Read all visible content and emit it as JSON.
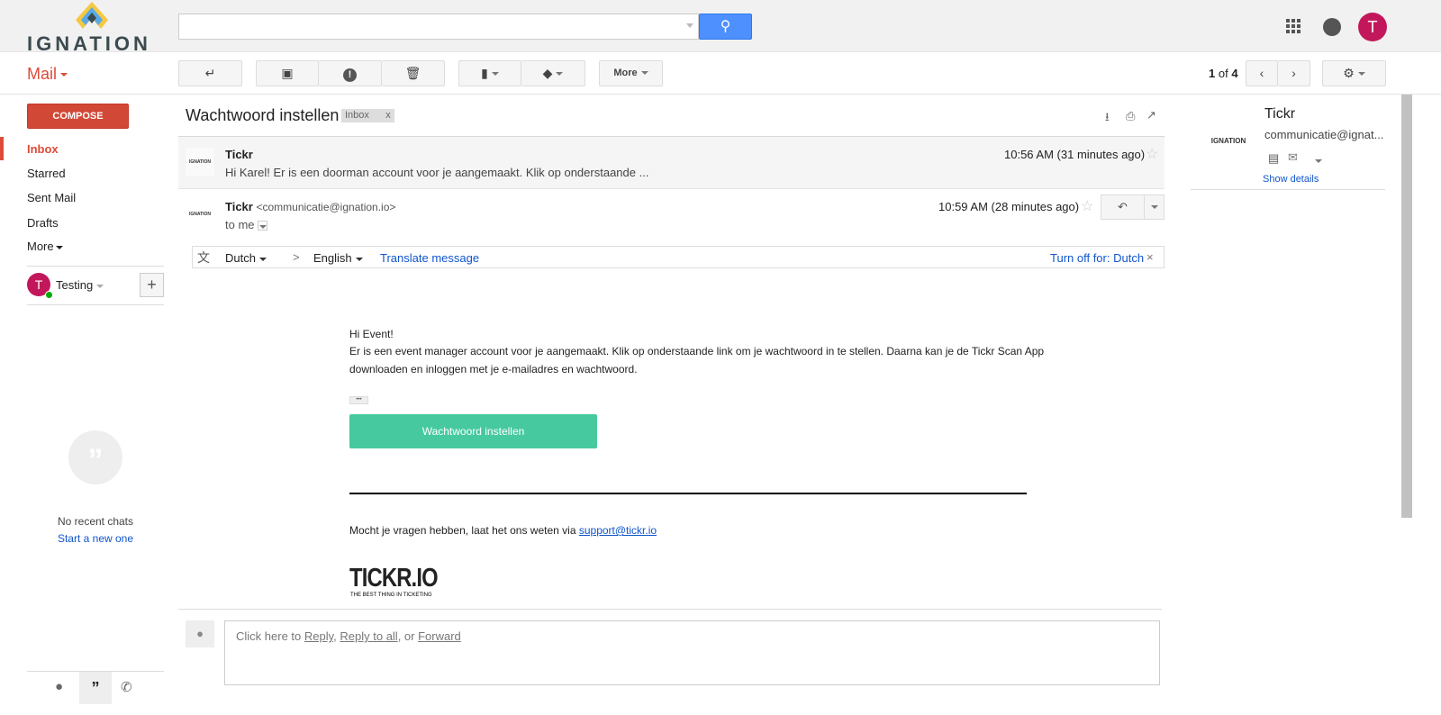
{
  "header": {
    "logo": "IGNATION",
    "search_value": "",
    "avatar_letter": "T"
  },
  "toolbar": {
    "app_label": "Mail",
    "more_label": "More",
    "pagination": {
      "current": "1",
      "of": "of",
      "total": "4"
    }
  },
  "sidebar": {
    "compose_label": "COMPOSE",
    "items": [
      {
        "label": "Inbox"
      },
      {
        "label": "Starred"
      },
      {
        "label": "Sent Mail"
      },
      {
        "label": "Drafts"
      },
      {
        "label": "More"
      }
    ],
    "chat_user": {
      "name": "Testing",
      "avatar_letter": "T"
    },
    "no_chats": "No recent chats",
    "start_new": "Start a new one"
  },
  "thread": {
    "subject": "Wachtwoord instellen",
    "label": "Inbox",
    "label_close": "x",
    "messages": [
      {
        "sender": "Tickr",
        "snippet": "Hi Karel! Er is een doorman account voor je aangemaakt. Klik op onderstaande ...",
        "time": "10:56 AM (31 minutes ago)",
        "logo": "IGNATION"
      },
      {
        "sender": "Tickr",
        "email": "<communicatie@ignation.io>",
        "to": "to me",
        "time": "10:59 AM (28 minutes ago)",
        "logo": "IGNATION"
      }
    ],
    "translate": {
      "from": "Dutch",
      "arrow": ">",
      "to": "English",
      "action": "Translate message",
      "turn_off": "Turn off for: Dutch",
      "close": "×"
    },
    "body": {
      "greeting": "Hi Event!",
      "line1": "Er is een event manager account voor je aangemaakt. Klik op onderstaande link om je wachtwoord in te stellen. Daarna kan je de Tickr Scan App",
      "line2": "downloaden en inloggen met je e-mailadres en wachtwoord.",
      "ellipsis": "•••",
      "cta": "Wachtwoord instellen",
      "questions": "Mocht je vragen hebben, laat het ons weten via ",
      "support_link": "support@tickr.io",
      "brand": "TICKR.IO",
      "tagline": "THE BEST THING IN TICKETING"
    },
    "reply": {
      "prefix": "Click here to ",
      "reply": "Reply",
      "sep1": ", ",
      "reply_all": "Reply to all",
      "sep2": ", or ",
      "forward": "Forward"
    }
  },
  "contact": {
    "name": "Tickr",
    "email": "communicatie@ignat...",
    "show_details": "Show details",
    "logo": "IGNATION"
  }
}
